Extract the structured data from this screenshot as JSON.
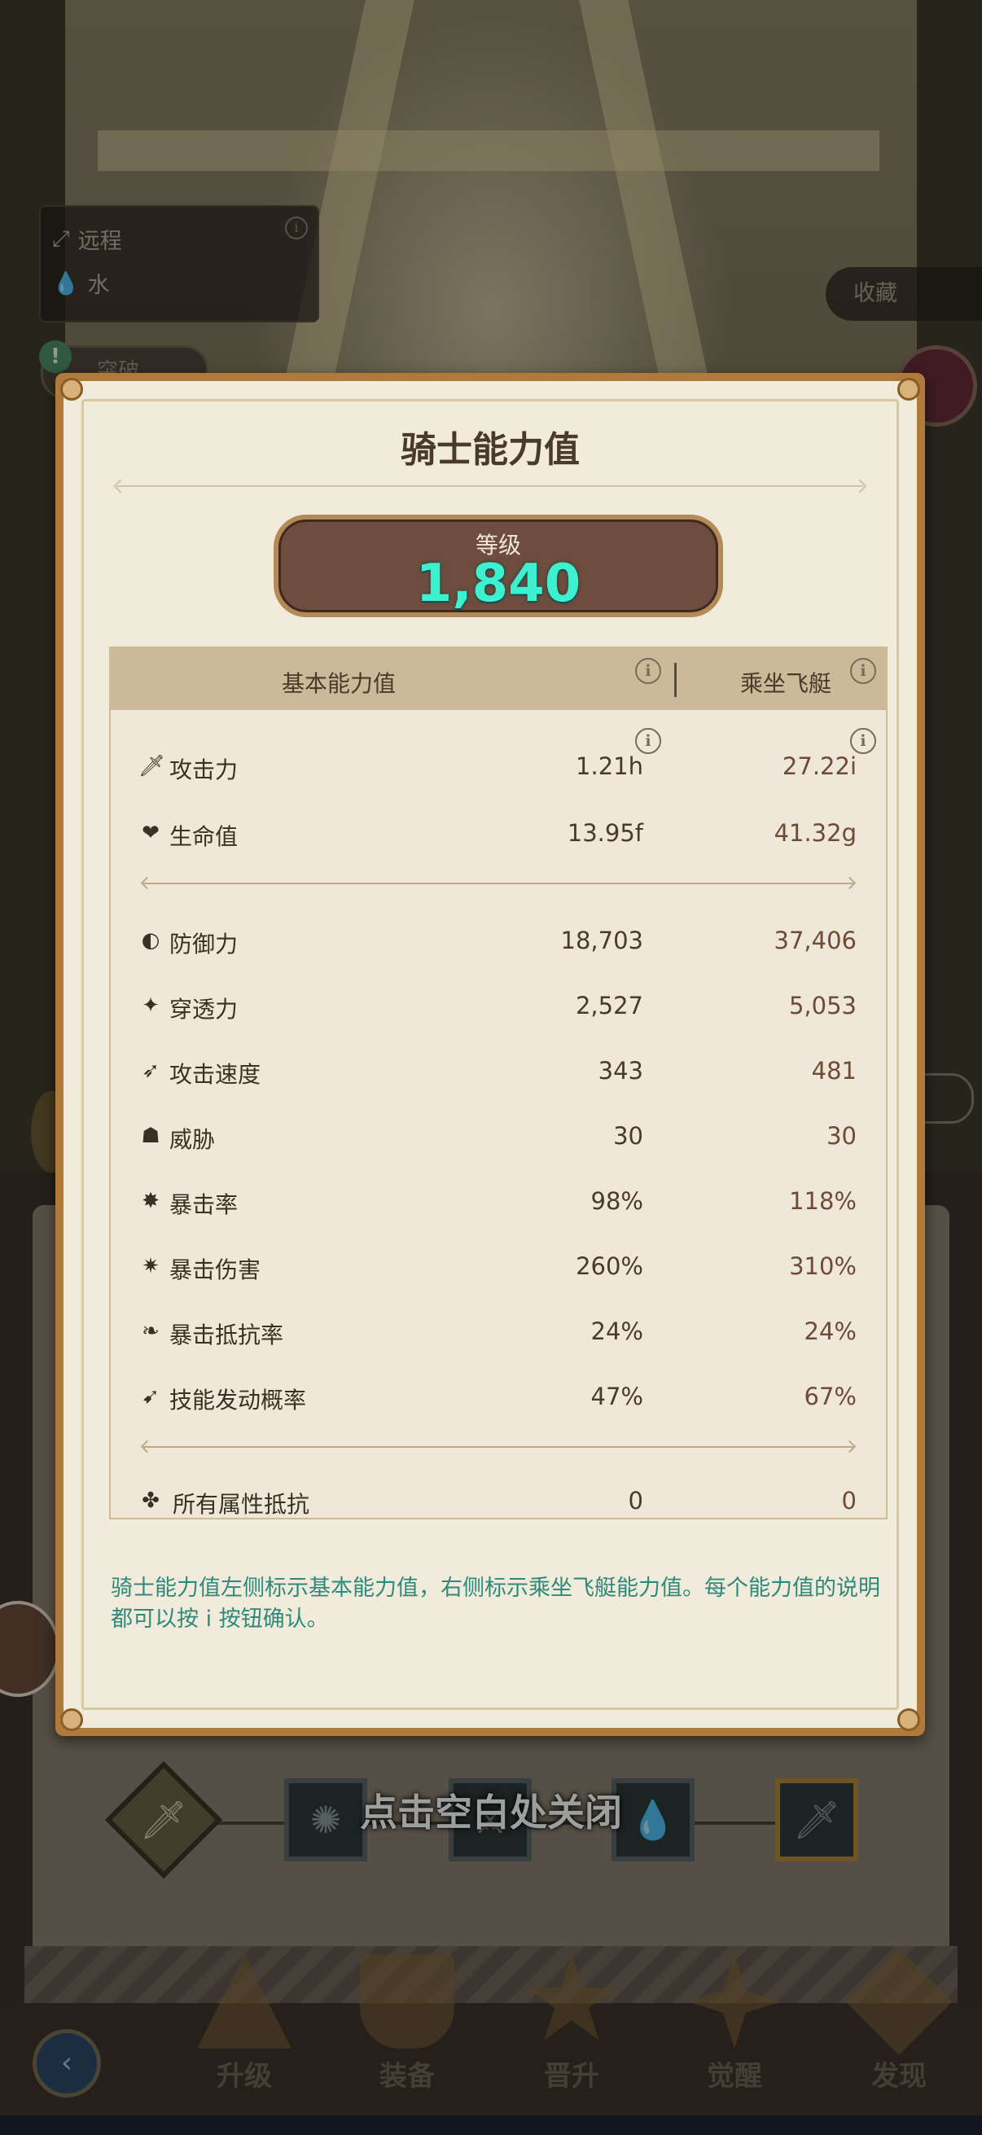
{
  "background": {
    "info_box": {
      "attack_type": "远程",
      "element": "水"
    },
    "favorite_button": "收藏",
    "left_bubble": "突破"
  },
  "modal": {
    "title": "骑士能力值",
    "level_label": "等级",
    "level_value": "1,840",
    "columns": {
      "basic": "基本能力值",
      "mount": "乘坐飞艇"
    },
    "stats_group1": [
      {
        "icon": "sword-icon",
        "label": "攻击力",
        "basic": "1.21h",
        "mount": "27.22i"
      },
      {
        "icon": "heart-icon",
        "label": "生命值",
        "basic": "13.95f",
        "mount": "41.32g"
      }
    ],
    "stats_group2": [
      {
        "icon": "shield-icon",
        "label": "防御力",
        "basic": "18,703",
        "mount": "37,406"
      },
      {
        "icon": "pierce-icon",
        "label": "穿透力",
        "basic": "2,527",
        "mount": "5,053"
      },
      {
        "icon": "attack-speed-icon",
        "label": "攻击速度",
        "basic": "343",
        "mount": "481"
      },
      {
        "icon": "threat-icon",
        "label": "威胁",
        "basic": "30",
        "mount": "30"
      },
      {
        "icon": "crit-rate-icon",
        "label": "暴击率",
        "basic": "98%",
        "mount": "118%"
      },
      {
        "icon": "crit-damage-icon",
        "label": "暴击伤害",
        "basic": "260%",
        "mount": "310%"
      },
      {
        "icon": "crit-resist-icon",
        "label": "暴击抵抗率",
        "basic": "24%",
        "mount": "24%"
      },
      {
        "icon": "skill-proc-icon",
        "label": "技能发动概率",
        "basic": "47%",
        "mount": "67%"
      }
    ],
    "stats_group3": [
      {
        "icon": "all-resist-icon",
        "label": "所有属性抵抗",
        "basic": "0",
        "mount": "0"
      }
    ],
    "footnote": "骑士能力值左侧标示基本能力值，右侧标示乘坐飞艇能力值。每个能力值的说明都可以按 i 按钮确认。"
  },
  "close_hint": "点击空白处关闭",
  "bottom_nav": [
    "升级",
    "装备",
    "晋升",
    "觉醒",
    "发现"
  ],
  "colors": {
    "level_value": "#3ff0d0",
    "footnote": "#2f8a7c",
    "modal_frame": "#b07a3a"
  }
}
